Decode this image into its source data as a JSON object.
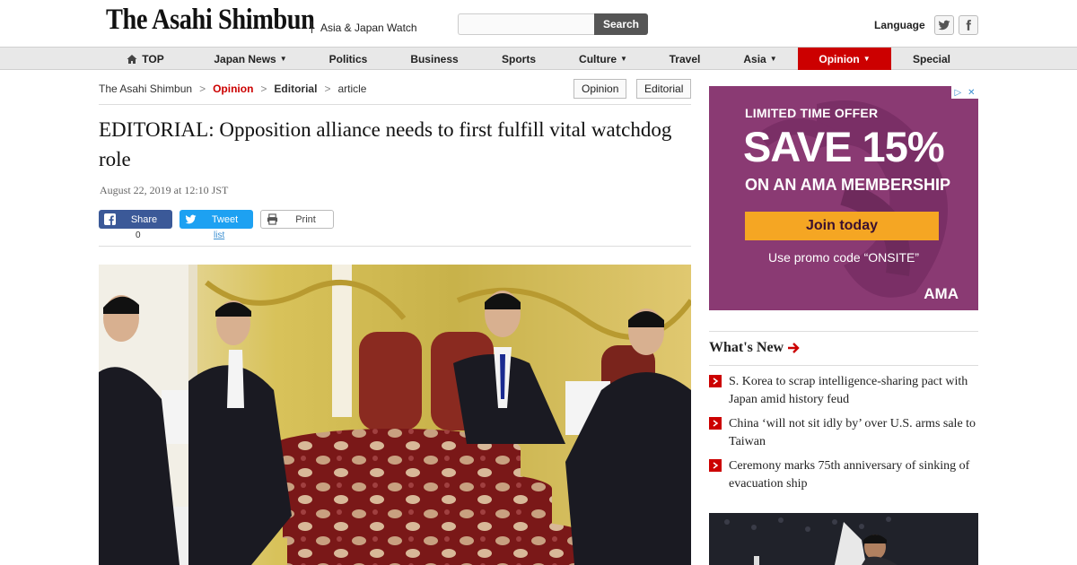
{
  "header": {
    "logo": "The Asahi Shimbun",
    "subtitle": "Asia & Japan Watch",
    "search_placeholder": "",
    "search_button": "Search",
    "language": "Language",
    "social_icons": [
      "twitter-icon",
      "facebook-icon"
    ]
  },
  "nav": {
    "items": [
      {
        "label": "TOP",
        "icon": "home-icon"
      },
      {
        "label": "Japan News",
        "dropdown": true
      },
      {
        "label": "Politics"
      },
      {
        "label": "Business"
      },
      {
        "label": "Sports"
      },
      {
        "label": "Culture",
        "dropdown": true
      },
      {
        "label": "Travel"
      },
      {
        "label": "Asia",
        "dropdown": true
      },
      {
        "label": "Opinion",
        "dropdown": true,
        "active": true
      },
      {
        "label": "Special"
      }
    ],
    "active_color": "#cc0000"
  },
  "breadcrumb": {
    "items": [
      "The Asahi Shimbun",
      "Opinion",
      "Editorial",
      "article"
    ],
    "separator": ">",
    "tags": [
      "Opinion",
      "Editorial"
    ]
  },
  "article": {
    "headline": "EDITORIAL: Opposition alliance needs to first fulfill vital watchdog role",
    "date": "August 22, 2019 at 12:10 JST",
    "share": {
      "label": "Share",
      "count": "0"
    },
    "tweet": {
      "label": "Tweet",
      "link": "list"
    },
    "print": {
      "label": "Print"
    }
  },
  "ad": {
    "line1": "LIMITED TIME OFFER",
    "line2": "SAVE 15%",
    "line3": "ON AN AMA MEMBERSHIP",
    "button": "Join today",
    "promo": "Use promo code “ONSITE”",
    "brand": "AMA"
  },
  "whats_new": {
    "title": "What's New",
    "items": [
      "S. Korea to scrap intelligence-sharing pact with Japan amid history feud",
      "China ‘will not sit idly by’ over U.S. arms sale to Taiwan",
      "Ceremony marks 75th anniversary of sinking of evacuation ship"
    ]
  },
  "colors": {
    "brand_red": "#cc0000",
    "facebook_blue": "#3b5998",
    "twitter_blue": "#1da1f2",
    "ad_purple": "#8a3a73",
    "ad_orange": "#f5a623"
  }
}
